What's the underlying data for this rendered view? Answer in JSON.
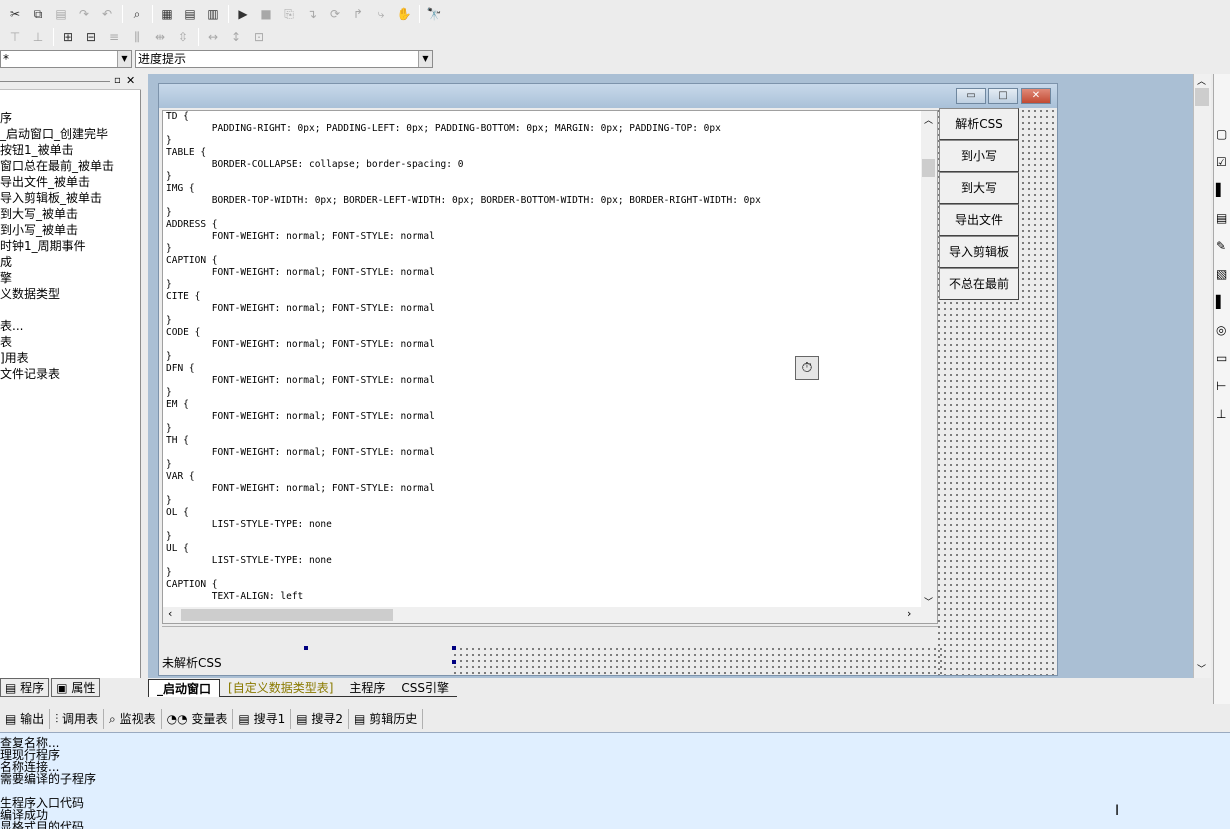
{
  "toolbar1": {
    "icons": [
      "cut-icon",
      "copy-icon",
      "paste-icon",
      "redo-icon",
      "undo-icon",
      "find-icon",
      "layout1-icon",
      "layout2-icon",
      "layout3-icon",
      "run-icon",
      "stop-icon",
      "step1-icon",
      "step2-icon",
      "step3-icon",
      "step4-icon",
      "step5-icon",
      "hand-icon",
      "binoculars-icon"
    ]
  },
  "selectors": {
    "object_value": "*",
    "event_value": "进度提示"
  },
  "left_tree": {
    "items": [
      "序",
      "_启动窗口_创建完毕",
      "按钮1_被单击",
      "窗口总在最前_被单击",
      "导出文件_被单击",
      "导入剪辑板_被单击",
      "到大写_被单击",
      "到小写_被单击",
      "时钟1_周期事件",
      "成",
      "擎",
      "义数据类型",
      "",
      "表...",
      "表",
      "]用表",
      "文件记录表"
    ]
  },
  "left_tabs": {
    "program": "程序",
    "properties": "属性"
  },
  "form": {
    "css_lines": [
      "TD {",
      "        PADDING-RIGHT: 0px; PADDING-LEFT: 0px; PADDING-BOTTOM: 0px; MARGIN: 0px; PADDING-TOP: 0px",
      "}",
      "TABLE {",
      "        BORDER-COLLAPSE: collapse; border-spacing: 0",
      "}",
      "IMG {",
      "        BORDER-TOP-WIDTH: 0px; BORDER-LEFT-WIDTH: 0px; BORDER-BOTTOM-WIDTH: 0px; BORDER-RIGHT-WIDTH: 0px",
      "}",
      "ADDRESS {",
      "        FONT-WEIGHT: normal; FONT-STYLE: normal",
      "}",
      "CAPTION {",
      "        FONT-WEIGHT: normal; FONT-STYLE: normal",
      "}",
      "CITE {",
      "        FONT-WEIGHT: normal; FONT-STYLE: normal",
      "}",
      "CODE {",
      "        FONT-WEIGHT: normal; FONT-STYLE: normal",
      "}",
      "DFN {",
      "        FONT-WEIGHT: normal; FONT-STYLE: normal",
      "}",
      "EM {",
      "        FONT-WEIGHT: normal; FONT-STYLE: normal",
      "}",
      "TH {",
      "        FONT-WEIGHT: normal; FONT-STYLE: normal",
      "}",
      "VAR {",
      "        FONT-WEIGHT: normal; FONT-STYLE: normal",
      "}",
      "OL {",
      "        LIST-STYLE-TYPE: none",
      "}",
      "UL {",
      "        LIST-STYLE-TYPE: none",
      "}",
      "CAPTION {",
      "        TEXT-ALIGN: left"
    ],
    "buttons": [
      "解析CSS",
      "到小写",
      "到大写",
      "导出文件",
      "导入剪辑板",
      "不总在最前"
    ],
    "status_label": "未解析CSS"
  },
  "module_tabs": [
    "_启动窗口",
    "[自定义数据类型表]",
    "主程序",
    "CSS引擎"
  ],
  "output_tabs": [
    "输出",
    "调用表",
    "监视表",
    "变量表",
    "搜寻1",
    "搜寻2",
    "剪辑历史"
  ],
  "output_lines": [
    "查复名称...",
    "理现行程序",
    "名称连接...",
    "需要编译的子程序",
    "",
    "生程序入口代码",
    "编译成功",
    "显格式目的代码"
  ],
  "colors": {
    "output_bg": "#e0efff",
    "design_bg": "#aabfd4",
    "active_module_tab": "#000000",
    "custom_type_tab": "#8a7a00"
  }
}
